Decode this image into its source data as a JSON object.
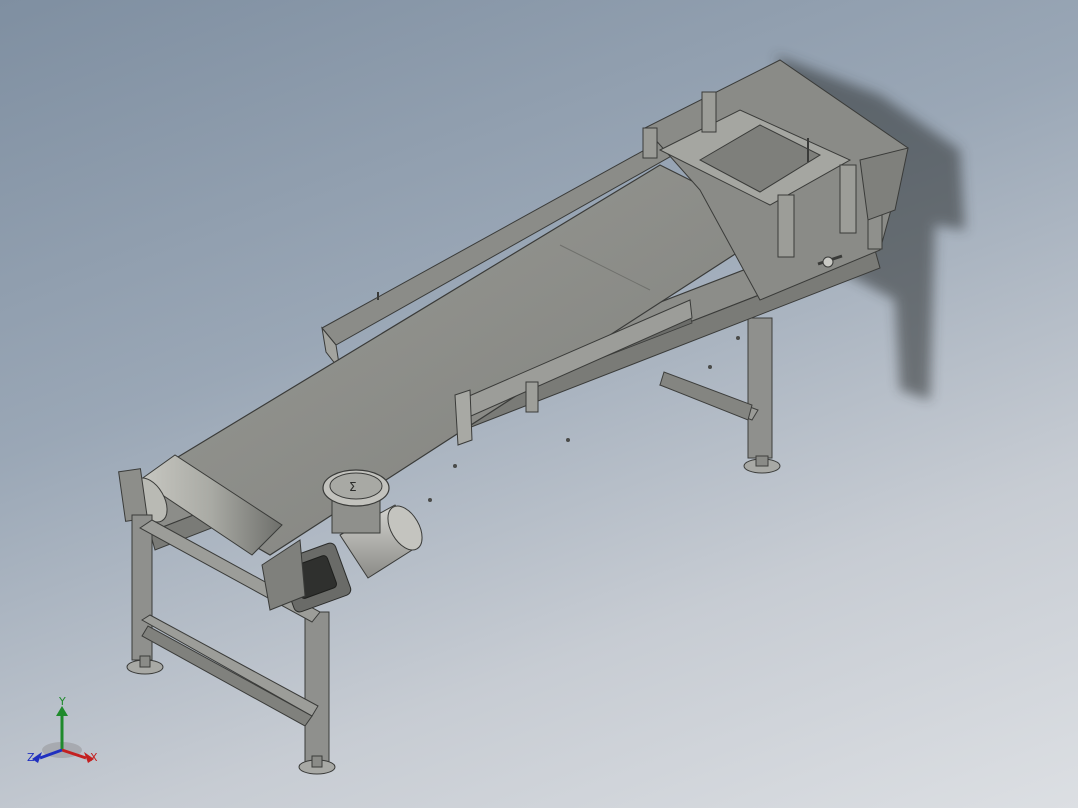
{
  "viewport": {
    "name": "3D model view",
    "background_top": "#7f8fa1",
    "background_bottom": "#dcdfe3"
  },
  "model": {
    "frame_color": "#8e8f8d",
    "belt_color": "#8a8b87",
    "motor_label": "Σ"
  },
  "triad": {
    "x_label": "X",
    "y_label": "Y",
    "z_label": "Z",
    "x_color": "#c42020",
    "y_color": "#1f8a2c",
    "z_color": "#2030c0"
  }
}
